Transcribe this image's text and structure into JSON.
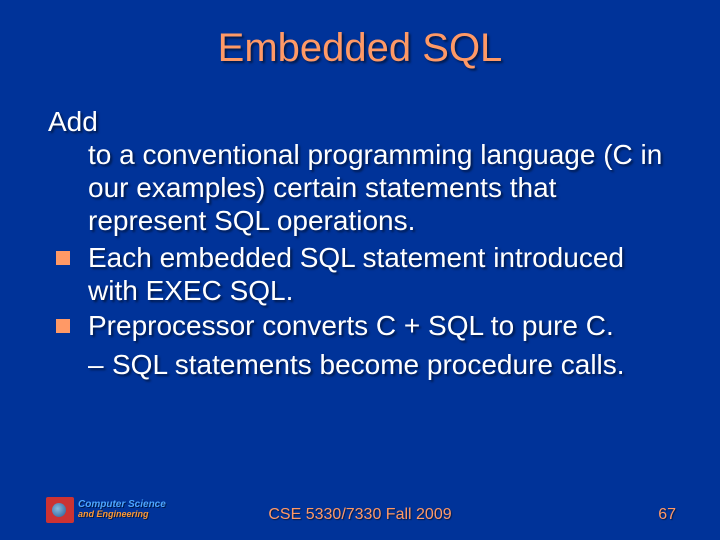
{
  "title": "Embedded SQL",
  "intro": {
    "lead": "Add",
    "rest": "to a conventional programming language (C in our examples) certain statements that represent SQL operations."
  },
  "bullets": [
    {
      "text": "Each embedded SQL statement introduced with EXEC SQL."
    },
    {
      "text": "Preprocessor converts C + SQL to pure C."
    }
  ],
  "sub_bullets": [
    {
      "dash": "–",
      "text": "SQL statements become procedure calls."
    }
  ],
  "footer": {
    "center": "CSE 5330/7330 Fall 2009",
    "page": "67"
  },
  "logo": {
    "line1": "Computer Science",
    "line2": "and Engineering"
  }
}
